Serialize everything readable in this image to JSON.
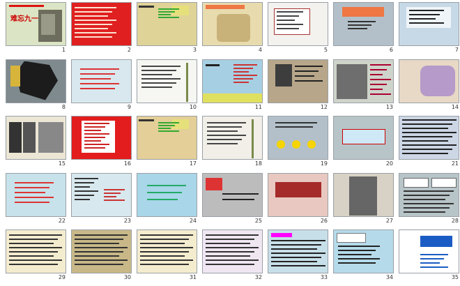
{
  "title_slide": {
    "heading": "难忘九一八"
  },
  "slide_numbers": [
    "1",
    "2",
    "3",
    "4",
    "5",
    "6",
    "7",
    "8",
    "9",
    "10",
    "11",
    "12",
    "13",
    "14",
    "15",
    "16",
    "17",
    "18",
    "19",
    "20",
    "21",
    "22",
    "23",
    "24",
    "25",
    "26",
    "27",
    "28",
    "29",
    "30",
    "31",
    "32",
    "33",
    "34",
    "35"
  ],
  "slides": [
    {
      "bg": "#dbe4c4",
      "variant": "title"
    },
    {
      "bg": "#e02020",
      "variant": "textRed"
    },
    {
      "bg": "#e0d398",
      "variant": "tree"
    },
    {
      "bg": "#e8dcae",
      "variant": "map"
    },
    {
      "bg": "#f3f2ee",
      "variant": "greyText"
    },
    {
      "bg": "#b3c0c9",
      "variant": "waterfall"
    },
    {
      "bg": "#c7d9e6",
      "variant": "sky"
    },
    {
      "bg": "#7e8a8e",
      "variant": "darkmap"
    },
    {
      "bg": "#d8e8ee",
      "variant": "pinktext"
    },
    {
      "bg": "#f6f6f2",
      "variant": "bamboo"
    },
    {
      "bg": "#a7cfe3",
      "variant": "twoCol"
    },
    {
      "bg": "#b7a68a",
      "variant": "portrait"
    },
    {
      "bg": "#cfd4cb",
      "variant": "photo"
    },
    {
      "bg": "#e7d9c5",
      "variant": "purplemap"
    },
    {
      "bg": "#ece6d5",
      "variant": "bwphotos"
    },
    {
      "bg": "#e31d1d",
      "variant": "redbox"
    },
    {
      "bg": "#e3cf97",
      "variant": "tree"
    },
    {
      "bg": "#f1efe8",
      "variant": "bamboo2"
    },
    {
      "bg": "#b3c0c9",
      "variant": "smileys"
    },
    {
      "bg": "#b7c4c8",
      "variant": "redcentertext"
    },
    {
      "bg": "#ccd6e5",
      "variant": "dense"
    },
    {
      "bg": "#c7e2ea",
      "variant": "pinktext2"
    },
    {
      "bg": "#d7e9ee",
      "variant": "tree2"
    },
    {
      "bg": "#a9d6e8",
      "variant": "bigcenter"
    },
    {
      "bg": "#bcbcbc",
      "variant": "greyheadline"
    },
    {
      "bg": "#e8c8c0",
      "variant": "redstrip"
    },
    {
      "bg": "#d8d2c6",
      "variant": "monument"
    },
    {
      "bg": "#b7c4c8",
      "variant": "boxes"
    },
    {
      "bg": "#f4eccf",
      "variant": "listfade"
    },
    {
      "bg": "#c8b888",
      "variant": "listfade2"
    },
    {
      "bg": "#f4eccf",
      "variant": "listfade3"
    },
    {
      "bg": "#f0e6f2",
      "variant": "listfade4"
    },
    {
      "bg": "#c7dfe8",
      "variant": "paragraph"
    },
    {
      "bg": "#b5dbea",
      "variant": "questionbox"
    },
    {
      "bg": "#ffffff",
      "variant": "logo"
    }
  ]
}
